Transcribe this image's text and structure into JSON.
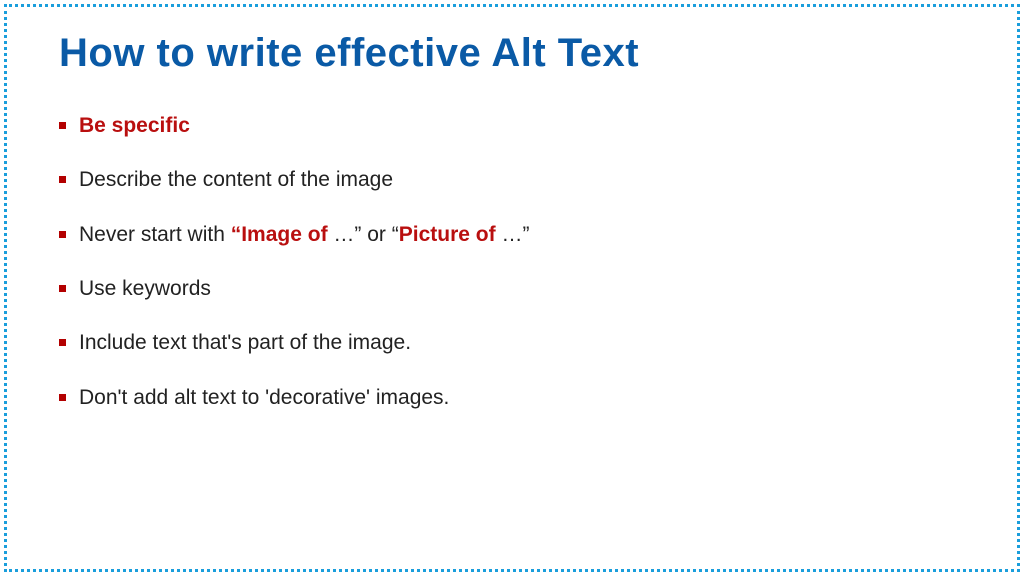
{
  "title": "How to write effective Alt Text",
  "items": {
    "i0": "Be specific",
    "i1": "Describe the content of the image",
    "i2_pre": "Never start with ",
    "i2_q1": "“",
    "i2_r1": "Image of",
    "i2_dots1": " …” ",
    "i2_mid": "or “",
    "i2_r2": "Picture of",
    "i2_dots2": " …”",
    "i3": "Use keywords",
    "i4": "Include text that's part of the image.",
    "i5": "Don't add alt text to 'decorative' images."
  }
}
